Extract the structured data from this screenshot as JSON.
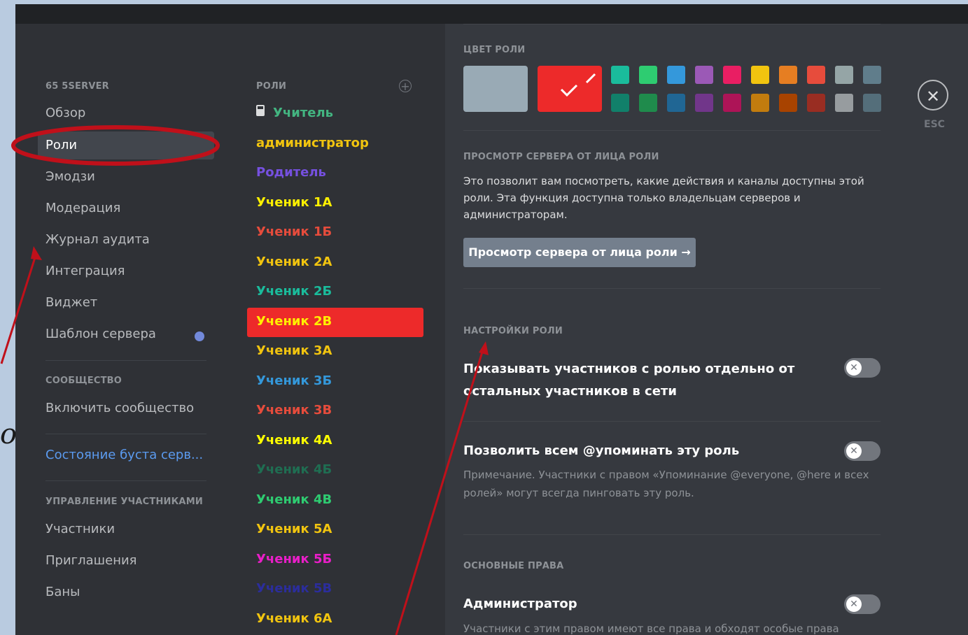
{
  "sidebar": {
    "server_header": "65 5SERVER",
    "items": [
      "Обзор",
      "Роли",
      "Эмодзи",
      "Модерация",
      "Журнал аудита",
      "Интеграция",
      "Виджет",
      "Шаблон сервера"
    ],
    "community_header": "СООБЩЕСТВО",
    "community_item": "Включить сообщество",
    "boost_item": "Состояние буста серв...",
    "members_header": "УПРАВЛЕНИЕ УЧАСТНИКАМИ",
    "member_items": [
      "Участники",
      "Приглашения",
      "Баны"
    ]
  },
  "roles": {
    "header": "РОЛИ",
    "lock_icon": "lock-icon",
    "items": [
      {
        "label": "Учитель",
        "color": "#43b581"
      },
      {
        "label": "администратор",
        "color": "#f1c40f"
      },
      {
        "label": "Родитель",
        "color": "#7650e0"
      },
      {
        "label": "Ученик 1А",
        "color": "#fff000"
      },
      {
        "label": "Ученик 1Б",
        "color": "#e74c3c"
      },
      {
        "label": "Ученик 2А",
        "color": "#f1c40f"
      },
      {
        "label": "Ученик 2Б",
        "color": "#1abc9c"
      },
      {
        "label": "Ученик 2В",
        "color": "#ffff00"
      },
      {
        "label": "Ученик 3А",
        "color": "#f1c40f"
      },
      {
        "label": "Ученик 3Б",
        "color": "#3498db"
      },
      {
        "label": "Ученик 3В",
        "color": "#e74c3c"
      },
      {
        "label": "Ученик 4А",
        "color": "#ffff00"
      },
      {
        "label": "Ученик 4Б",
        "color": "#1f6e52"
      },
      {
        "label": "Ученик 4В",
        "color": "#2ecc71"
      },
      {
        "label": "Ученик 5А",
        "color": "#f1c40f"
      },
      {
        "label": "Ученик 5Б",
        "color": "#e91ec8"
      },
      {
        "label": "Ученик 5В",
        "color": "#2b2d9c"
      },
      {
        "label": "Ученик 6А",
        "color": "#f1c40f"
      }
    ],
    "selected_index": 7,
    "selected_color": "#ed2a2a"
  },
  "settings": {
    "color_header": "ЦВЕТ РОЛИ",
    "default_color": "#99aab5",
    "selected_color": "#ed2a2a",
    "palette_top": [
      "#1abc9c",
      "#2ecc71",
      "#3498db",
      "#9b59b6",
      "#e91e63",
      "#f1c40f",
      "#e67e22",
      "#e74c3c",
      "#95a5a6",
      "#607d8b"
    ],
    "palette_bottom": [
      "#11806a",
      "#1f8b4c",
      "#206694",
      "#71368a",
      "#ad1457",
      "#c27c0e",
      "#a84300",
      "#992d22",
      "#979c9f",
      "#546e7a"
    ],
    "view_header": "ПРОСМОТР СЕРВЕРА ОТ ЛИЦА РОЛИ",
    "view_description": "Это позволит вам посмотреть, какие действия и каналы доступны этой роли. Эта функция доступна только владельцам серверов и администраторам.",
    "view_button": "Просмотр сервера от лица роли →",
    "role_settings_header": "НАСТРОЙКИ РОЛИ",
    "hoist_label": "Показывать участников с ролью отдельно от остальных участников в сети",
    "mention_label": "Позволить всем @упоминать эту роль",
    "mention_note": "Примечание. Участники с правом «Упоминание @everyone, @here и всех ролей» могут всегда пинговать эту роль.",
    "permissions_header": "ОСНОВНЫЕ ПРАВА",
    "admin_label": "Администратор",
    "admin_note": "Участники с этим правом имеют все права и обходят особые права",
    "toggle_glyph": "✕"
  },
  "close": {
    "glyph": "✕",
    "label": "ESC"
  },
  "annotation": {
    "stray_text": "о",
    "highlight_color": "#c0101a",
    "arrow_color": "#c0101a"
  }
}
